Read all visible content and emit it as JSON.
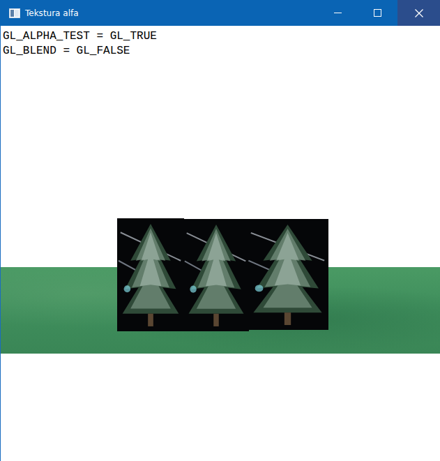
{
  "window": {
    "title": "Tekstura alfa"
  },
  "overlay": [
    "GL_ALPHA_TEST = GL_TRUE",
    "GL_BLEND = GL_FALSE"
  ]
}
